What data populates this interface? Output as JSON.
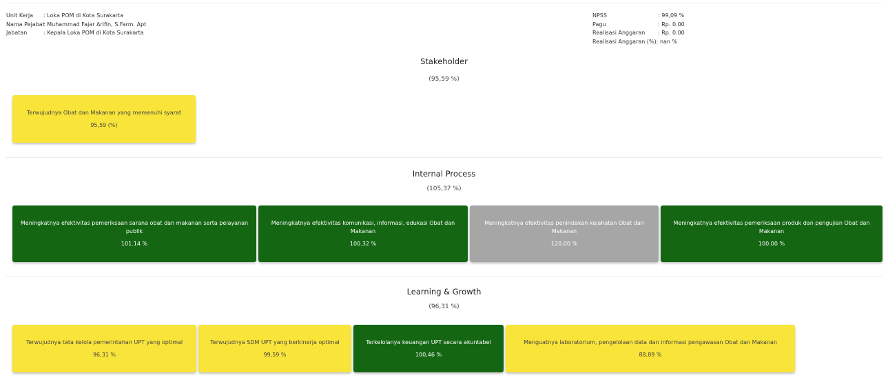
{
  "header": {
    "left": [
      {
        "label": "Unit Kerja",
        "value": ": Loka POM di Kota Surakarta"
      },
      {
        "label": "Nama Pejabat",
        "value": ": Muhammad Fajar Arifin, S.Farm. Apt"
      },
      {
        "label": "Jabatan",
        "value": ": Kepala Loka POM di Kota Surakarta"
      }
    ],
    "right": [
      {
        "label": "NPSS",
        "value": ": 99,09 %"
      },
      {
        "label": "Pagu",
        "value": ": Rp. 0.00"
      },
      {
        "label": "Realisasi Anggaran",
        "value": ": Rp. 0.00"
      },
      {
        "label": "Realisasi Anggaran (%)",
        "value": ": nan %"
      }
    ]
  },
  "sections": [
    {
      "title": "Stakeholder",
      "score": "(95,59 %)",
      "cards": [
        {
          "title": "Terwujudnya Obat dan Makanan yang memenuhi syarat",
          "value": "95,59 (%)",
          "color": "#f9e43a"
        }
      ]
    },
    {
      "title": "Internal Process",
      "score": "(105,37 %)",
      "cards": [
        {
          "title": "Meningkatnya efektivitas pemeriksaan sarana obat dan makanan serta pelayanan publik",
          "value": "101.14 %",
          "color": "#146613"
        },
        {
          "title": "Meningkatnya efektivitas komunikasi, informasi, edukasi Obat dan Makanan",
          "value": "100.32 %",
          "color": "#146613"
        },
        {
          "title": "Meningkatnya efektivitas penindakan kejahatan Obat dan Makanan",
          "value": "120.00 %",
          "color": "#a6a6a6"
        },
        {
          "title": "Meningkatnya efektivitas pemeriksaan produk dan pengujian Obat dan Makanan",
          "value": "100.00 %",
          "color": "#146613"
        }
      ]
    },
    {
      "title": "Learning & Growth",
      "score": "(96,31 %)",
      "cards": [
        {
          "title": "Terwujudnya tata kelola pemerintahan UPT yang optimal",
          "value": "96,31 %",
          "color": "#f9e43a"
        },
        {
          "title": "Terwujudnya SDM UPT yang berkinerja optimal",
          "value": "99,59 %",
          "color": "#f9e43a"
        },
        {
          "title": "Terkelolanya keuangan UPT secara akuntabel",
          "value": "100,46 %",
          "color": "#146613"
        },
        {
          "title": "Menguatnya laboratorium, pengelolaan data dan informasi pengawasan Obat dan Makanan",
          "value": "88,89 %",
          "color": "#f9e43a"
        }
      ]
    }
  ]
}
